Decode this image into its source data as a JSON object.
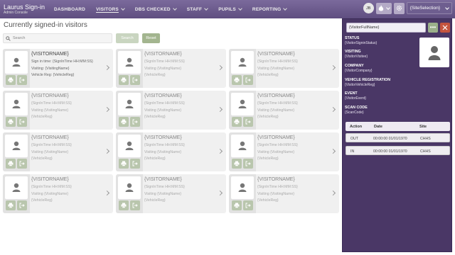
{
  "brand": {
    "title": "Laurus Sign-in",
    "subtitle": "Admin Console"
  },
  "nav": [
    {
      "label": "DASHBOARD",
      "dropdown": false,
      "active": false
    },
    {
      "label": "VISITORS",
      "dropdown": true,
      "active": true
    },
    {
      "label": "DBS CHECKED",
      "dropdown": true,
      "active": false
    },
    {
      "label": "STAFF",
      "dropdown": true,
      "active": false
    },
    {
      "label": "PUPILS",
      "dropdown": true,
      "active": false
    },
    {
      "label": "REPORTING",
      "dropdown": true,
      "active": false
    }
  ],
  "header_right": {
    "user_initials": "JB",
    "site_selection": "{SiteSelection}"
  },
  "page": {
    "title": "Currently signed-in visitors"
  },
  "search": {
    "placeholder": "Search",
    "search_label": "Search",
    "reset_label": "Reset"
  },
  "cards": [
    {
      "name": "{VISITORNAME}",
      "line1": "Sign in time: {SignInTime HH:MM:SS}",
      "line2": "Visiting: {VisitingName}",
      "line3": "Vehicle Reg: {VehicleReg}"
    },
    {
      "name": "{VISITORNAME}",
      "line1": "{SignInTime HH:MM:SS}",
      "line2": "Visiting {VisitingName}",
      "line3": "{VehicleReg}"
    },
    {
      "name": "{VISITORNAME}",
      "line1": "{SignInTime HH:MM:SS}",
      "line2": "Visiting {VisitingName}",
      "line3": "{VehicleReg}"
    },
    {
      "name": "{VISITORNAME}",
      "line1": "{SignInTime HH:MM:SS}",
      "line2": "Visiting {VisitingName}",
      "line3": "{VehicleReg}"
    },
    {
      "name": "{VISITORNAME}",
      "line1": "{SignInTime HH:MM:SS}",
      "line2": "Visiting {VisitingName}",
      "line3": "{VehicleReg}"
    },
    {
      "name": "{VISITORNAME}",
      "line1": "{SignInTime HH:MM:SS}",
      "line2": "Visiting {VisitingName}",
      "line3": "{VehicleReg}"
    },
    {
      "name": "{VISITORNAME}",
      "line1": "{SignInTime HH:MM:SS}",
      "line2": "Visiting {VisitingName}",
      "line3": "{VehicleReg}"
    },
    {
      "name": "{VISITORNAME}",
      "line1": "{SignInTime HH:MM:SS}",
      "line2": "Visiting {VisitingName}",
      "line3": "{VehicleReg}"
    },
    {
      "name": "{VISITORNAME}",
      "line1": "{SignInTime HH:MM:SS}",
      "line2": "Visiting {VisitingName}",
      "line3": "{VehicleReg}"
    },
    {
      "name": "{VISITORNAME}",
      "line1": "{SignInTime HH:MM:SS}",
      "line2": "Visiting {VisitingName}",
      "line3": "{VehicleReg}"
    },
    {
      "name": "{VISITORNAME}",
      "line1": "{SignInTime HH:MM:SS}",
      "line2": "Visiting {VisitingName}",
      "line3": "{VehicleReg}"
    },
    {
      "name": "{VISITORNAME}",
      "line1": "{SignInTime HH:MM:SS}",
      "line2": "Visiting {VisitingName}",
      "line3": "{VehicleReg}"
    }
  ],
  "panel": {
    "full_name": "{VisitorFullName}",
    "more_label": "•••",
    "fields": [
      {
        "label": "STATUS",
        "value": "{VisitorSigninStatus}"
      },
      {
        "label": "VISITING",
        "value": "{VisitorVisitee}"
      },
      {
        "label": "COMPANY",
        "value": "{VisitorCompany}"
      },
      {
        "label": "VEHICLE REGISTRATION",
        "value": "{VisitorVehicleReg}"
      },
      {
        "label": "EVENT",
        "value": "{VisitorEvent}"
      },
      {
        "label": "SCAN CODE",
        "value": "{ScanCode}"
      }
    ],
    "history": {
      "headers": [
        "Action",
        "Date",
        "Site"
      ],
      "rows": [
        {
          "action": "OUT",
          "date": "00:00:00 01/01/1970",
          "site": "CHHS"
        },
        {
          "action": "IN",
          "date": "00:00:00 01/01/1970",
          "site": "CHHS"
        }
      ]
    }
  },
  "colors": {
    "nav_bg": "#6a5a8c",
    "panel_bg": "#4a3766",
    "accent_green": "#a3b58f",
    "close_red": "#c4543e"
  }
}
